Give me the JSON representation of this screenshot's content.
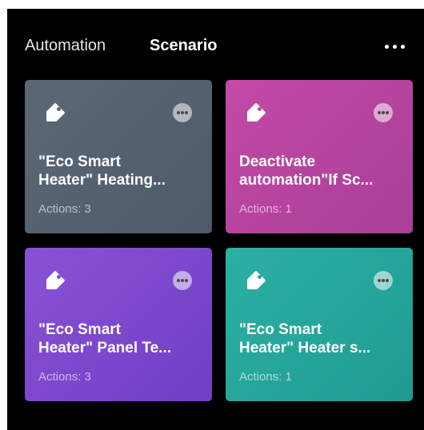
{
  "tabs": {
    "automation": "Automation",
    "scenario": "Scenario"
  },
  "header": {
    "menu_icon": "more-horizontal-icon"
  },
  "cards": [
    {
      "title": "\"Eco Smart\nHeater\" Heating...",
      "actions": "Actions: 3",
      "color": "#56636f",
      "icon": "tag-icon"
    },
    {
      "title": "Deactivate\nautomation\"If Sc...",
      "actions": "Actions: 1",
      "color": "#b8449f",
      "icon": "tag-icon"
    },
    {
      "title": "\"Eco Smart\nHeater\" Panel Te...",
      "actions": "Actions: 3",
      "color": "#7c48cd",
      "icon": "tag-icon"
    },
    {
      "title": "\"Eco Smart\nHeater\" Heater s...",
      "actions": "Actions: 1",
      "color": "#26a69a",
      "icon": "tag-icon"
    }
  ],
  "colors": {
    "background": "#000000",
    "text": "#ffffff"
  }
}
